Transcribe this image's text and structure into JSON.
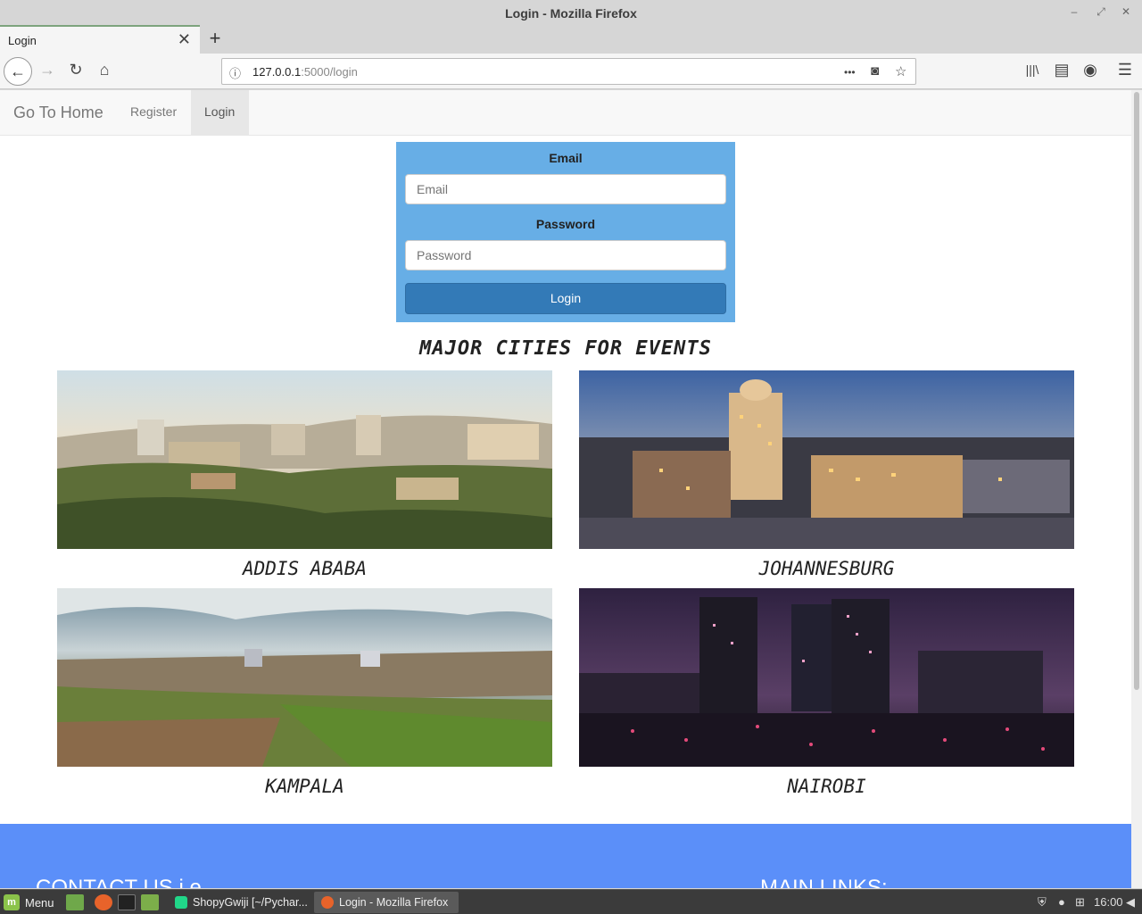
{
  "window": {
    "title": "Login - Mozilla Firefox",
    "controls": [
      "–",
      "⤢",
      "✕"
    ]
  },
  "tab": {
    "label": "Login",
    "close": "✕",
    "new": "+"
  },
  "toolbar": {
    "back": "←",
    "forward": "→",
    "reload": "↻",
    "home": "⌂",
    "url_host": "127.0.0.1",
    "url_path": ":5000/login",
    "info": "ⓘ",
    "more": "•••",
    "pocket": "◙",
    "star": "☆",
    "library": "|||\\",
    "sidebar": "▤",
    "account": "◉",
    "menu": "☰"
  },
  "navbar": {
    "brand": "Go To Home",
    "links": [
      {
        "label": "Register"
      },
      {
        "label": "Login"
      }
    ]
  },
  "login_form": {
    "email_label": "Email",
    "email_placeholder": "Email",
    "password_label": "Password",
    "password_placeholder": "Password",
    "submit_label": "Login"
  },
  "cities": {
    "title": "MAJOR CITIES FOR EVENTS",
    "items": [
      {
        "name": "ADDIS ABABA"
      },
      {
        "name": "JOHANNESBURG"
      },
      {
        "name": "KAMPALA"
      },
      {
        "name": "NAIROBI"
      }
    ]
  },
  "footer": {
    "contact_heading": "CONTACT US i.e",
    "links_heading": "MAIN LINKS:"
  },
  "taskbar": {
    "menu_label": "Menu",
    "tasks": [
      {
        "label": "ShopyGwiji [~/Pychar..."
      },
      {
        "label": "Login - Mozilla Firefox"
      }
    ],
    "clock": "16:00"
  },
  "colors": {
    "login_box": "#67aee6",
    "login_button": "#337ab7",
    "footer": "#5b8ff9"
  }
}
